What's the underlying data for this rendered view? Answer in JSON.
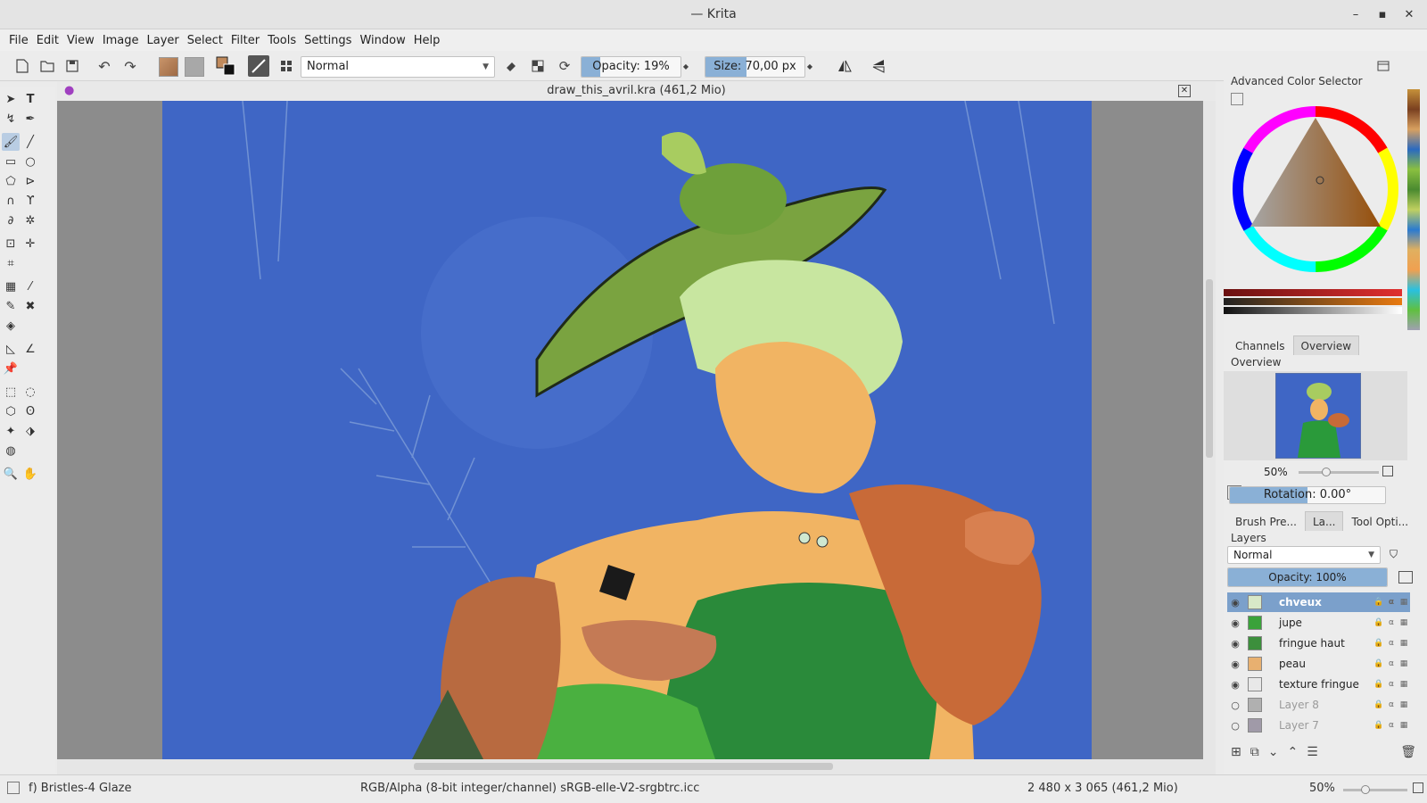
{
  "window": {
    "title": "— Krita",
    "minimize": "–",
    "maximize": "▪",
    "close": "✕"
  },
  "menu": [
    "File",
    "Edit",
    "View",
    "Image",
    "Layer",
    "Select",
    "Filter",
    "Tools",
    "Settings",
    "Window",
    "Help"
  ],
  "toolbar": {
    "blend_mode": "Normal",
    "opacity_label": "Opacity: 19%",
    "opacity_value": 19,
    "size_label": "Size: 70,00 px",
    "size_value": 70,
    "fg_color": "#c08a5c",
    "bg_color": "#a8a8a8"
  },
  "document": {
    "title": "draw_this_avril.kra (461,2 Mio)"
  },
  "dockers": {
    "color_selector": {
      "title": "Advanced Color Selector",
      "hue_color": "#e87a10"
    },
    "tabs_top": {
      "channels": "Channels",
      "overview": "Overview"
    },
    "overview": {
      "title": "Overview",
      "zoom": "50%",
      "rotation": "Rotation: 0.00°"
    },
    "tabs_mid": {
      "brush_presets": "Brush Pre...",
      "layers_short": "La...",
      "tool_options": "Tool Opti..."
    },
    "layers": {
      "title": "Layers",
      "blend_mode": "Normal",
      "opacity": "Opacity:  100%",
      "items": [
        {
          "name": "chveux",
          "visible": true,
          "selected": true,
          "color": "#d8e8c8"
        },
        {
          "name": "jupe",
          "visible": true,
          "selected": false,
          "color": "#3aa23a"
        },
        {
          "name": "fringue haut",
          "visible": true,
          "selected": false,
          "color": "#3c8f3c"
        },
        {
          "name": "peau",
          "visible": true,
          "selected": false,
          "color": "#e8b070"
        },
        {
          "name": "texture fringue",
          "visible": true,
          "selected": false,
          "color": "#e8e8e8"
        },
        {
          "name": "Layer 8",
          "visible": false,
          "selected": false,
          "color": "#b0b0b0"
        },
        {
          "name": "Layer 7",
          "visible": false,
          "selected": false,
          "color": "#a09aa8"
        }
      ]
    }
  },
  "status": {
    "brush": "f) Bristles-4 Glaze",
    "color_space": "RGB/Alpha (8-bit integer/channel)  sRGB-elle-V2-srgbtrc.icc",
    "dimensions": "2 480 x 3 065 (461,2 Mio)",
    "zoom": "50%"
  }
}
